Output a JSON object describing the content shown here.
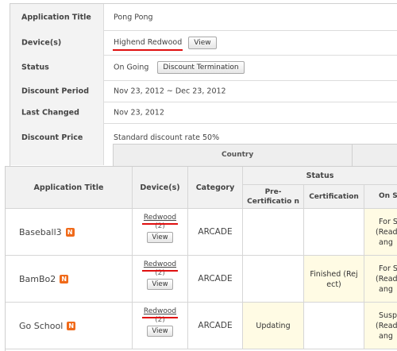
{
  "detail": {
    "application_title": {
      "label": "Application Title",
      "value": "Pong Pong"
    },
    "devices": {
      "label": "Device(s)",
      "value": "Highend Redwood",
      "button": "View"
    },
    "status": {
      "label": "Status",
      "value": "On Going",
      "button": "Discount Termination"
    },
    "discount_period": {
      "label": "Discount Period",
      "value": "Nov 23, 2012 ~ Dec 23, 2012"
    },
    "last_changed": {
      "label": "Last Changed",
      "value": "Nov 23, 2012"
    },
    "discount_price": {
      "label": "Discount Price",
      "value": "Standard discount rate 50%"
    },
    "country_header": "Country"
  },
  "grid": {
    "headers": {
      "application_title": "Application Title",
      "devices": "Device(s)",
      "category": "Category",
      "status": "Status",
      "pre_certification": "Pre-Certificatio n",
      "certification": "Certification",
      "on_sale": "On S"
    },
    "new_badge": "N",
    "rows": [
      {
        "title": "Baseball3",
        "device": "Redwood",
        "device_count": "(2)",
        "view": "View",
        "category": "ARCADE",
        "pre_cert": "",
        "cert": "",
        "on_sale_1": "For S",
        "on_sale_2": "(Ready",
        "on_sale_3": "ang"
      },
      {
        "title": "BamBo2",
        "device": "Redwood",
        "device_count": "(2)",
        "view": "View",
        "category": "ARCADE",
        "pre_cert": "",
        "cert_1": "Finished (Rej",
        "cert_2": "ect)",
        "on_sale_1": "For S",
        "on_sale_2": "(Ready",
        "on_sale_3": "ang"
      },
      {
        "title": "Go School",
        "device": "Redwood",
        "device_count": "(2)",
        "view": "View",
        "category": "ARCADE",
        "pre_cert": "Updating",
        "cert": "",
        "on_sale_1": "Susp",
        "on_sale_2": "(Ready",
        "on_sale_3": "ang"
      }
    ]
  },
  "colors": {
    "highlight_yellow": "#fffbe4",
    "underline_red": "#e01010",
    "badge_orange": "#f06a1a"
  }
}
